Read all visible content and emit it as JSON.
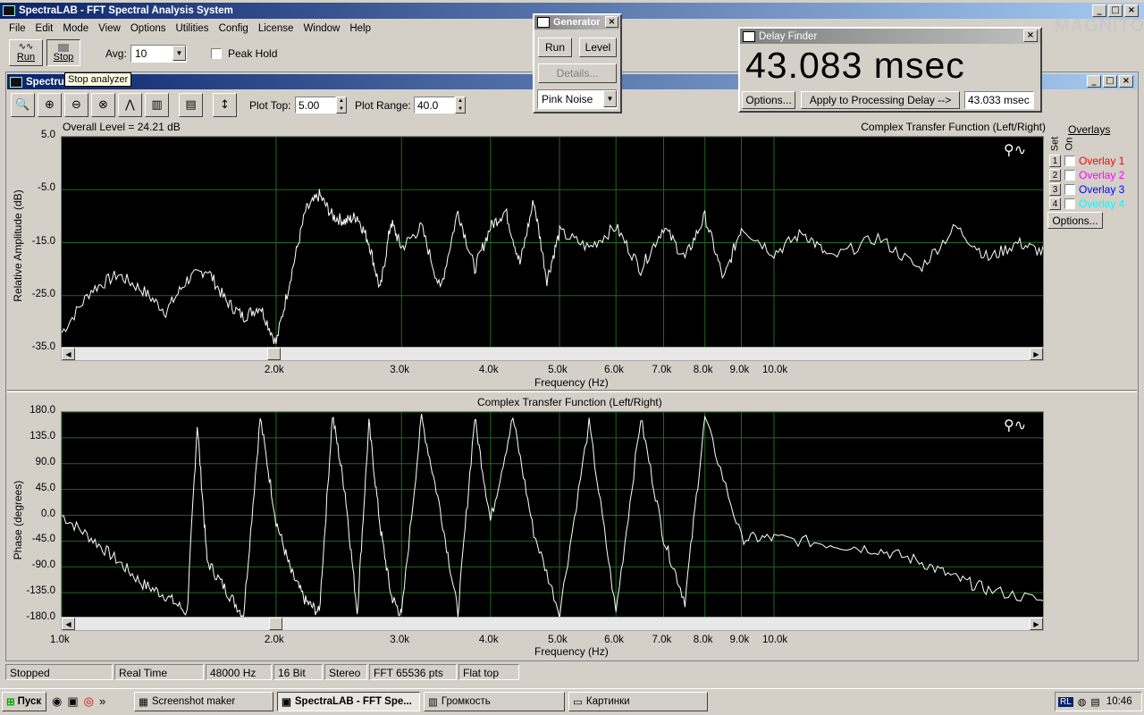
{
  "window": {
    "title": "SpectraLAB - FFT Spectral Analysis System"
  },
  "menu": [
    "File",
    "Edit",
    "Mode",
    "View",
    "Options",
    "Utilities",
    "Config",
    "License",
    "Window",
    "Help"
  ],
  "toolbar": {
    "run_label": "Run",
    "stop_label": "Stop",
    "avg_label": "Avg:",
    "avg_value": "10",
    "peak_hold_label": "Peak Hold",
    "tooltip": "Stop analyzer"
  },
  "generator": {
    "title": "Generator",
    "run_label": "Run",
    "level_label": "Level",
    "details_label": "Details...",
    "noise_value": "Pink Noise"
  },
  "delay_finder": {
    "title": "Delay Finder",
    "value": "43.083 msec",
    "options_label": "Options...",
    "apply_label": "Apply to Processing Delay -->",
    "applied_value": "43.033 msec"
  },
  "spectrum": {
    "title": "Spectrum",
    "plot_top_label": "Plot Top:",
    "plot_top_value": "5.00",
    "plot_range_label": "Plot Range:",
    "plot_range_value": "40.0"
  },
  "overlays": {
    "heading": "Overlays",
    "set_label": "Set",
    "on_label": "On",
    "options_label": "Options...",
    "items": [
      {
        "num": "1",
        "label": "Overlay 1",
        "color": "#ff0000"
      },
      {
        "num": "2",
        "label": "Overlay 2",
        "color": "#ff00ff"
      },
      {
        "num": "3",
        "label": "Overlay 3",
        "color": "#0000ff"
      },
      {
        "num": "4",
        "label": "Overlay 4",
        "color": "#00ffff"
      }
    ]
  },
  "chart_data": [
    {
      "type": "line",
      "title": "Complex Transfer Function (Left/Right)",
      "annotation": "Overall Level = 24.21 dB",
      "xlabel": "Frequency (Hz)",
      "ylabel": "Relative Amplitude (dB)",
      "x_scale": "log",
      "xlim": [
        1000,
        24000
      ],
      "ylim": [
        -35,
        5
      ],
      "y_ticks": [
        "5.0",
        "-5.0",
        "-15.0",
        "-25.0",
        "-35.0"
      ],
      "x_ticks": [
        "2.0k",
        "3.0k",
        "4.0k",
        "5.0k",
        "6.0k",
        "7.0k",
        "8.0k",
        "9.0k",
        "10.0k"
      ],
      "grid": true,
      "series": [
        {
          "x": [
            1000,
            1100,
            1200,
            1300,
            1400,
            1500,
            1600,
            1700,
            1800,
            1900,
            2000,
            2100,
            2200,
            2300,
            2400,
            2500,
            2600,
            2700,
            2800,
            2900,
            3000,
            3200,
            3400,
            3600,
            3800,
            4000,
            4200,
            4400,
            4600,
            4800,
            5000,
            5500,
            6000,
            6500,
            7000,
            7500,
            8000,
            8500,
            9000,
            10000,
            11000,
            12000,
            14000,
            16000,
            18000,
            20000,
            22000,
            24000
          ],
          "y": [
            -32,
            -24,
            -21,
            -24,
            -28,
            -22,
            -20,
            -26,
            -29,
            -27,
            -34,
            -21,
            -9,
            -6,
            -10,
            -11,
            -10,
            -15,
            -24,
            -11,
            -16,
            -12,
            -24,
            -9,
            -20,
            -12,
            -9,
            -19,
            -7,
            -22,
            -13,
            -16,
            -12,
            -20,
            -12,
            -18,
            -10,
            -22,
            -12,
            -17,
            -13,
            -18,
            -14,
            -20,
            -12,
            -18,
            -15,
            -17
          ]
        }
      ]
    },
    {
      "type": "line",
      "title": "Complex Transfer Function (Left/Right)",
      "xlabel": "Frequency (Hz)",
      "ylabel": "Phase (degrees)",
      "x_scale": "log",
      "xlim": [
        1000,
        24000
      ],
      "ylim": [
        -180,
        180
      ],
      "y_ticks": [
        "180.0",
        "135.0",
        "90.0",
        "45.0",
        "0.0",
        "-45.0",
        "-90.0",
        "-135.0",
        "-180.0"
      ],
      "x_ticks": [
        "1.0k",
        "2.0k",
        "3.0k",
        "4.0k",
        "5.0k",
        "6.0k",
        "7.0k",
        "8.0k",
        "9.0k",
        "10.0k"
      ],
      "grid": true,
      "series": [
        {
          "x": [
            1000,
            1100,
            1200,
            1300,
            1400,
            1500,
            1550,
            1600,
            1700,
            1800,
            1900,
            2000,
            2100,
            2200,
            2300,
            2400,
            2500,
            2600,
            2700,
            2800,
            2900,
            3000,
            3200,
            3400,
            3600,
            3800,
            4000,
            4300,
            4600,
            5000,
            5500,
            6000,
            6500,
            7000,
            7500,
            8000,
            9000,
            10000,
            12000,
            14000,
            16000,
            18000,
            20000,
            24000
          ],
          "y": [
            0,
            -40,
            -80,
            -120,
            -140,
            -170,
            160,
            -80,
            -130,
            -175,
            170,
            -10,
            -100,
            -150,
            -170,
            175,
            40,
            -170,
            160,
            -20,
            -140,
            -175,
            170,
            10,
            -170,
            170,
            -10,
            170,
            -30,
            -170,
            160,
            -170,
            170,
            -40,
            -150,
            170,
            -40,
            -40,
            -50,
            -60,
            -80,
            -110,
            -130,
            -150
          ]
        }
      ]
    }
  ],
  "status": [
    "Stopped",
    "Real Time",
    "48000 Hz",
    "16 Bit",
    "Stereo",
    "FFT 65536 pts",
    "Flat top"
  ],
  "taskbar": {
    "start_label": "Пуск",
    "items": [
      "Screenshot maker",
      "SpectraLAB - FFT Spe...",
      "Громкость",
      "Картинки"
    ],
    "lang": "RL",
    "time": "10:46"
  },
  "logo": "MAGNITOLA"
}
